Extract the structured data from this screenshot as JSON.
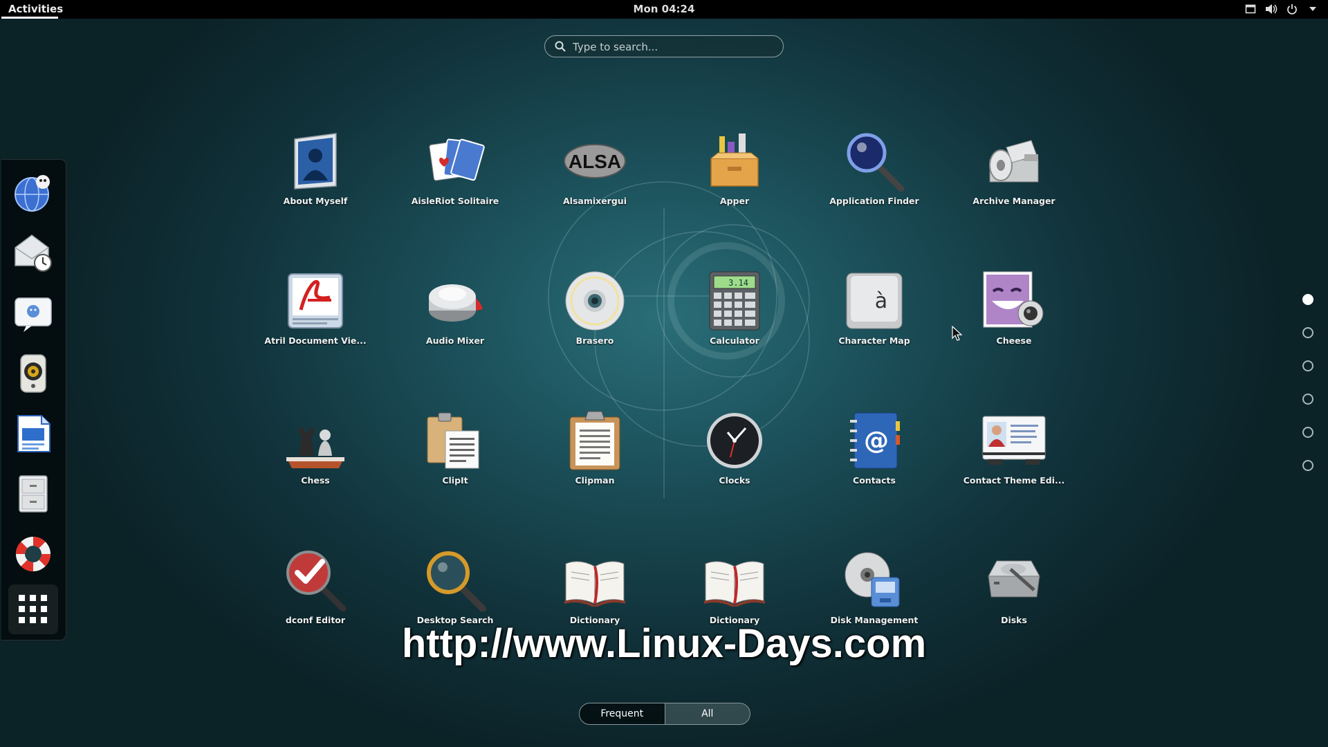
{
  "topbar": {
    "activities": "Activities",
    "clock": "Mon 04:24",
    "tray_icons": [
      "window-icon",
      "volume-icon",
      "power-icon",
      "chevron-down-icon"
    ]
  },
  "search": {
    "placeholder": "Type to search..."
  },
  "dash": {
    "items": [
      {
        "name": "web-browser",
        "icon": "globe-icon"
      },
      {
        "name": "evolution-mail",
        "icon": "mail-clock-icon"
      },
      {
        "name": "empathy-chat",
        "icon": "chat-icon"
      },
      {
        "name": "rhythmbox",
        "icon": "speaker-icon"
      },
      {
        "name": "writer",
        "icon": "document-icon"
      },
      {
        "name": "files",
        "icon": "cabinet-icon"
      },
      {
        "name": "help",
        "icon": "lifebuoy-icon"
      },
      {
        "name": "show-applications",
        "icon": "grid-icon"
      }
    ]
  },
  "apps": [
    {
      "label": "About Myself",
      "icon": "person-icon"
    },
    {
      "label": "AisleRiot Solitaire",
      "icon": "cards-icon"
    },
    {
      "label": "Alsamixergui",
      "icon": "alsa-icon"
    },
    {
      "label": "Apper",
      "icon": "box-icon"
    },
    {
      "label": "Application Finder",
      "icon": "magnifier-icon"
    },
    {
      "label": "Archive Manager",
      "icon": "archive-icon"
    },
    {
      "label": "Atril Document Vie...",
      "icon": "pdf-icon"
    },
    {
      "label": "Audio Mixer",
      "icon": "knob-icon"
    },
    {
      "label": "Brasero",
      "icon": "disc-icon"
    },
    {
      "label": "Calculator",
      "icon": "calculator-icon"
    },
    {
      "label": "Character Map",
      "icon": "key-icon"
    },
    {
      "label": "Cheese",
      "icon": "webcam-icon"
    },
    {
      "label": "Chess",
      "icon": "chess-icon"
    },
    {
      "label": "ClipIt",
      "icon": "clipboard-icon"
    },
    {
      "label": "Clipman",
      "icon": "clipboard-icon"
    },
    {
      "label": "Clocks",
      "icon": "clock-icon"
    },
    {
      "label": "Contacts",
      "icon": "address-book-icon"
    },
    {
      "label": "Contact Theme Edi...",
      "icon": "contact-card-icon"
    },
    {
      "label": "dconf Editor",
      "icon": "check-magnifier-icon"
    },
    {
      "label": "Desktop Search",
      "icon": "magnifier-icon"
    },
    {
      "label": "Dictionary",
      "icon": "book-icon"
    },
    {
      "label": "Dictionary",
      "icon": "book-icon"
    },
    {
      "label": "Disk Management",
      "icon": "disk-management-icon"
    },
    {
      "label": "Disks",
      "icon": "disks-icon"
    }
  ],
  "alsa_text": "ALSA",
  "charmap_glyph": "à",
  "calc_display": "3.14",
  "pagination": {
    "pages": 6,
    "active": 1
  },
  "watermark": "http://www.Linux-Days.com",
  "view_toggle": {
    "frequent": "Frequent",
    "all": "All"
  }
}
